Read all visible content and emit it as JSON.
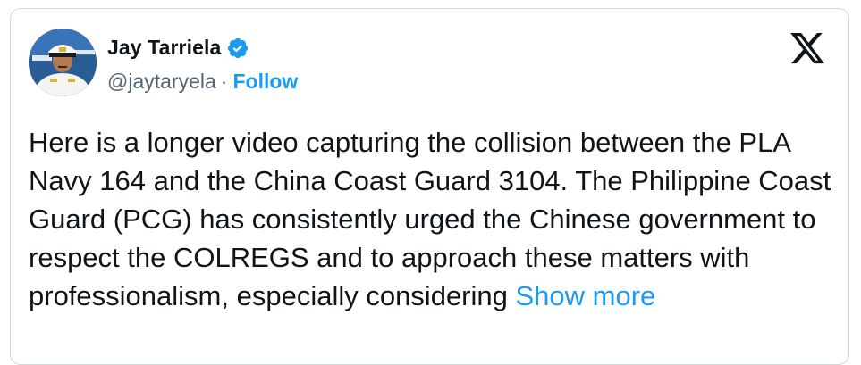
{
  "tweet": {
    "author": {
      "display_name": "Jay Tarriela",
      "handle": "@jaytaryela",
      "verified": true,
      "separator": "·",
      "follow_label": "Follow"
    },
    "text": "Here is a longer video capturing the collision between the PLA Navy 164 and the China Coast Guard 3104. The Philippine Coast Guard (PCG) has consistently urged the Chinese government to respect the COLREGS and to approach these matters with professionalism, especially considering",
    "show_more_label": "Show more"
  },
  "icons": {
    "verified": "verified-badge-icon",
    "brand": "x-logo-icon",
    "avatar": "profile-photo"
  },
  "colors": {
    "accent": "#1d9bf0",
    "text_primary": "#0f1419",
    "text_secondary": "#536471",
    "border": "#cfd9de"
  }
}
